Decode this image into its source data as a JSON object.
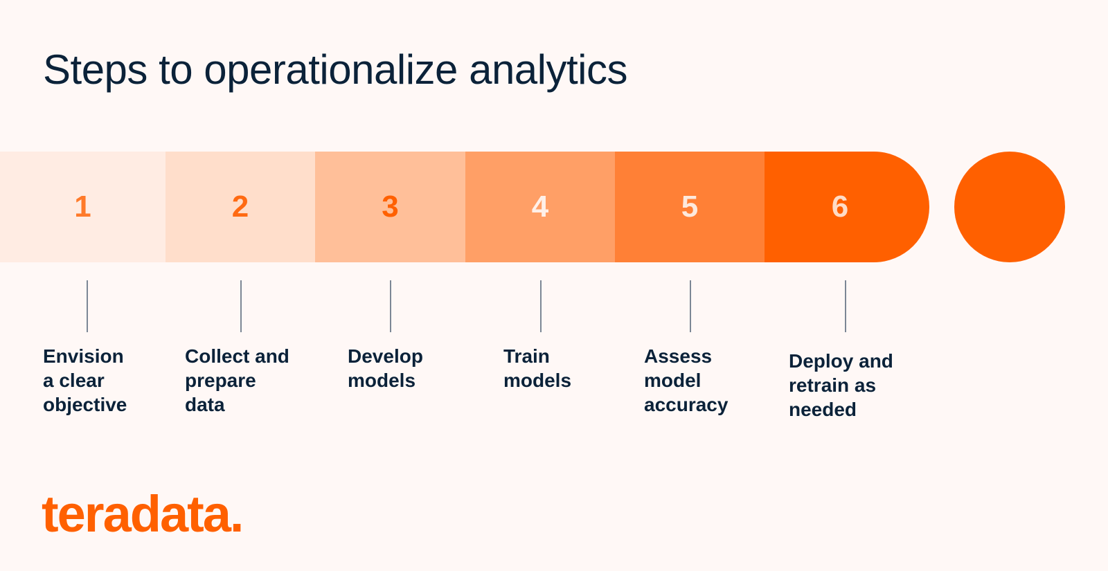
{
  "title": "Steps to operationalize analytics",
  "steps": [
    {
      "number": "1",
      "label": "Envision\na clear\nobjective",
      "fill": "#ffece3",
      "text_color": "#ff7a2a"
    },
    {
      "number": "2",
      "label": "Collect and\nprepare\ndata",
      "fill": "#ffdecb",
      "text_color": "#ff6a12"
    },
    {
      "number": "3",
      "label": "Develop\nmodels",
      "fill": "#ffbf99",
      "text_color": "#ff6000"
    },
    {
      "number": "4",
      "label": "Train\nmodels",
      "fill": "#ff9f66",
      "text_color": "#fff0e8"
    },
    {
      "number": "5",
      "label": "Assess\nmodel\naccuracy",
      "fill": "#ff8036",
      "text_color": "#fde9dd"
    },
    {
      "number": "6",
      "label": "Deploy and\nretrain as\nneeded",
      "fill": "#ff6000",
      "text_color": "#ffdcc6"
    }
  ],
  "end_marker_color": "#ff6000",
  "brand": {
    "logo_text": "teradata.",
    "color": "#ff6000"
  }
}
